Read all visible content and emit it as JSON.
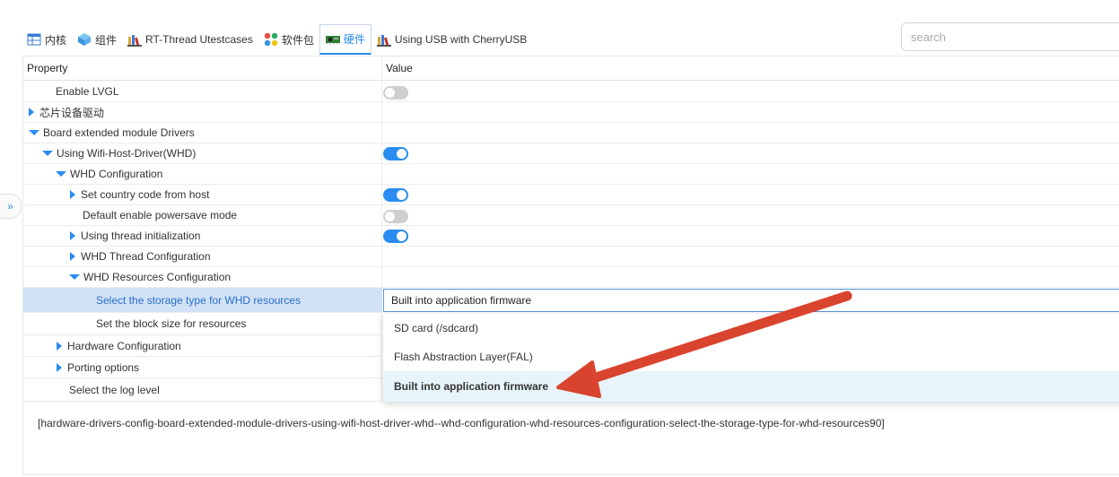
{
  "tabs": [
    {
      "label": "内核",
      "icon": "table-icon"
    },
    {
      "label": "组件",
      "icon": "cube-icon"
    },
    {
      "label": "RT-Thread Utestcases",
      "icon": "books-icon"
    },
    {
      "label": "软件包",
      "icon": "dots-icon"
    },
    {
      "label": "硬件",
      "icon": "board-icon"
    },
    {
      "label": "Using USB with CherryUSB",
      "icon": "books-icon"
    }
  ],
  "search": {
    "placeholder": "search"
  },
  "sidebar": {
    "toggle": "»"
  },
  "table": {
    "col_property": "Property",
    "col_value": "Value",
    "rows": [
      {
        "label": "Enable LVGL",
        "expander": "none",
        "value": "off"
      },
      {
        "label": "芯片设备驱动",
        "expander": "collapsed",
        "value": "none"
      },
      {
        "label": "Board extended module Drivers",
        "expander": "expanded",
        "value": "none"
      },
      {
        "label": "Using Wifi-Host-Driver(WHD)",
        "expander": "expanded",
        "value": "on"
      },
      {
        "label": "WHD Configuration",
        "expander": "expanded",
        "value": "none"
      },
      {
        "label": "Set country code from host",
        "expander": "collapsed",
        "value": "on"
      },
      {
        "label": "Default enable powersave mode",
        "expander": "none",
        "value": "off"
      },
      {
        "label": "Using thread initialization",
        "expander": "collapsed",
        "value": "on"
      },
      {
        "label": "WHD Thread Configuration",
        "expander": "collapsed",
        "value": "none"
      },
      {
        "label": "WHD Resources Configuration",
        "expander": "expanded",
        "value": "none"
      },
      {
        "label": "Select the storage type for WHD resources",
        "expander": "none",
        "value": "select",
        "selected": true
      },
      {
        "label": "Set the block size for resources",
        "expander": "none",
        "value": "none"
      },
      {
        "label": "Hardware Configuration",
        "expander": "collapsed",
        "value": "none"
      },
      {
        "label": "Porting options",
        "expander": "collapsed",
        "value": "none"
      },
      {
        "label": "Select the log level",
        "expander": "none",
        "value": "none"
      }
    ]
  },
  "select": {
    "value": "Built into application firmware",
    "options": [
      "SD card (/sdcard)",
      "Flash Abstraction Layer(FAL)",
      "Built into application firmware"
    ],
    "current_option": "Built into application firmware"
  },
  "footer": {
    "config_key": "[hardware-drivers-config-board-extended-module-drivers-using-wifi-host-driver-whd--whd-configuration-whd-resources-configuration-select-the-storage-type-for-whd-resources90]"
  },
  "colors": {
    "accent": "#2a8cf0",
    "selected_row": "#d1e2f6",
    "annotation_arrow": "#d9442e"
  }
}
